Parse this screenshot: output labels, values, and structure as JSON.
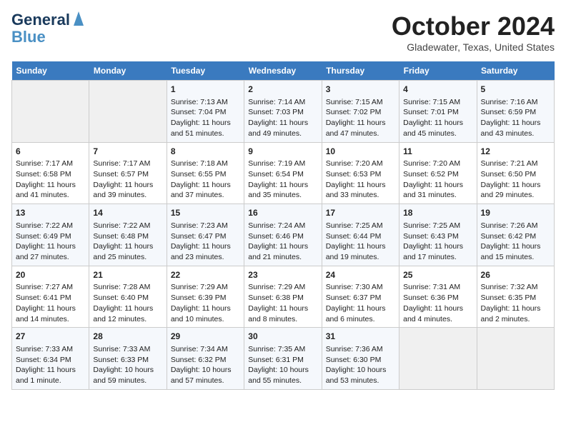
{
  "header": {
    "logo_line1": "General",
    "logo_line2": "Blue",
    "month": "October 2024",
    "location": "Gladewater, Texas, United States"
  },
  "days_of_week": [
    "Sunday",
    "Monday",
    "Tuesday",
    "Wednesday",
    "Thursday",
    "Friday",
    "Saturday"
  ],
  "weeks": [
    [
      {
        "day": "",
        "content": ""
      },
      {
        "day": "",
        "content": ""
      },
      {
        "day": "1",
        "content": "Sunrise: 7:13 AM\nSunset: 7:04 PM\nDaylight: 11 hours and 51 minutes."
      },
      {
        "day": "2",
        "content": "Sunrise: 7:14 AM\nSunset: 7:03 PM\nDaylight: 11 hours and 49 minutes."
      },
      {
        "day": "3",
        "content": "Sunrise: 7:15 AM\nSunset: 7:02 PM\nDaylight: 11 hours and 47 minutes."
      },
      {
        "day": "4",
        "content": "Sunrise: 7:15 AM\nSunset: 7:01 PM\nDaylight: 11 hours and 45 minutes."
      },
      {
        "day": "5",
        "content": "Sunrise: 7:16 AM\nSunset: 6:59 PM\nDaylight: 11 hours and 43 minutes."
      }
    ],
    [
      {
        "day": "6",
        "content": "Sunrise: 7:17 AM\nSunset: 6:58 PM\nDaylight: 11 hours and 41 minutes."
      },
      {
        "day": "7",
        "content": "Sunrise: 7:17 AM\nSunset: 6:57 PM\nDaylight: 11 hours and 39 minutes."
      },
      {
        "day": "8",
        "content": "Sunrise: 7:18 AM\nSunset: 6:55 PM\nDaylight: 11 hours and 37 minutes."
      },
      {
        "day": "9",
        "content": "Sunrise: 7:19 AM\nSunset: 6:54 PM\nDaylight: 11 hours and 35 minutes."
      },
      {
        "day": "10",
        "content": "Sunrise: 7:20 AM\nSunset: 6:53 PM\nDaylight: 11 hours and 33 minutes."
      },
      {
        "day": "11",
        "content": "Sunrise: 7:20 AM\nSunset: 6:52 PM\nDaylight: 11 hours and 31 minutes."
      },
      {
        "day": "12",
        "content": "Sunrise: 7:21 AM\nSunset: 6:50 PM\nDaylight: 11 hours and 29 minutes."
      }
    ],
    [
      {
        "day": "13",
        "content": "Sunrise: 7:22 AM\nSunset: 6:49 PM\nDaylight: 11 hours and 27 minutes."
      },
      {
        "day": "14",
        "content": "Sunrise: 7:22 AM\nSunset: 6:48 PM\nDaylight: 11 hours and 25 minutes."
      },
      {
        "day": "15",
        "content": "Sunrise: 7:23 AM\nSunset: 6:47 PM\nDaylight: 11 hours and 23 minutes."
      },
      {
        "day": "16",
        "content": "Sunrise: 7:24 AM\nSunset: 6:46 PM\nDaylight: 11 hours and 21 minutes."
      },
      {
        "day": "17",
        "content": "Sunrise: 7:25 AM\nSunset: 6:44 PM\nDaylight: 11 hours and 19 minutes."
      },
      {
        "day": "18",
        "content": "Sunrise: 7:25 AM\nSunset: 6:43 PM\nDaylight: 11 hours and 17 minutes."
      },
      {
        "day": "19",
        "content": "Sunrise: 7:26 AM\nSunset: 6:42 PM\nDaylight: 11 hours and 15 minutes."
      }
    ],
    [
      {
        "day": "20",
        "content": "Sunrise: 7:27 AM\nSunset: 6:41 PM\nDaylight: 11 hours and 14 minutes."
      },
      {
        "day": "21",
        "content": "Sunrise: 7:28 AM\nSunset: 6:40 PM\nDaylight: 11 hours and 12 minutes."
      },
      {
        "day": "22",
        "content": "Sunrise: 7:29 AM\nSunset: 6:39 PM\nDaylight: 11 hours and 10 minutes."
      },
      {
        "day": "23",
        "content": "Sunrise: 7:29 AM\nSunset: 6:38 PM\nDaylight: 11 hours and 8 minutes."
      },
      {
        "day": "24",
        "content": "Sunrise: 7:30 AM\nSunset: 6:37 PM\nDaylight: 11 hours and 6 minutes."
      },
      {
        "day": "25",
        "content": "Sunrise: 7:31 AM\nSunset: 6:36 PM\nDaylight: 11 hours and 4 minutes."
      },
      {
        "day": "26",
        "content": "Sunrise: 7:32 AM\nSunset: 6:35 PM\nDaylight: 11 hours and 2 minutes."
      }
    ],
    [
      {
        "day": "27",
        "content": "Sunrise: 7:33 AM\nSunset: 6:34 PM\nDaylight: 11 hours and 1 minute."
      },
      {
        "day": "28",
        "content": "Sunrise: 7:33 AM\nSunset: 6:33 PM\nDaylight: 10 hours and 59 minutes."
      },
      {
        "day": "29",
        "content": "Sunrise: 7:34 AM\nSunset: 6:32 PM\nDaylight: 10 hours and 57 minutes."
      },
      {
        "day": "30",
        "content": "Sunrise: 7:35 AM\nSunset: 6:31 PM\nDaylight: 10 hours and 55 minutes."
      },
      {
        "day": "31",
        "content": "Sunrise: 7:36 AM\nSunset: 6:30 PM\nDaylight: 10 hours and 53 minutes."
      },
      {
        "day": "",
        "content": ""
      },
      {
        "day": "",
        "content": ""
      }
    ]
  ]
}
